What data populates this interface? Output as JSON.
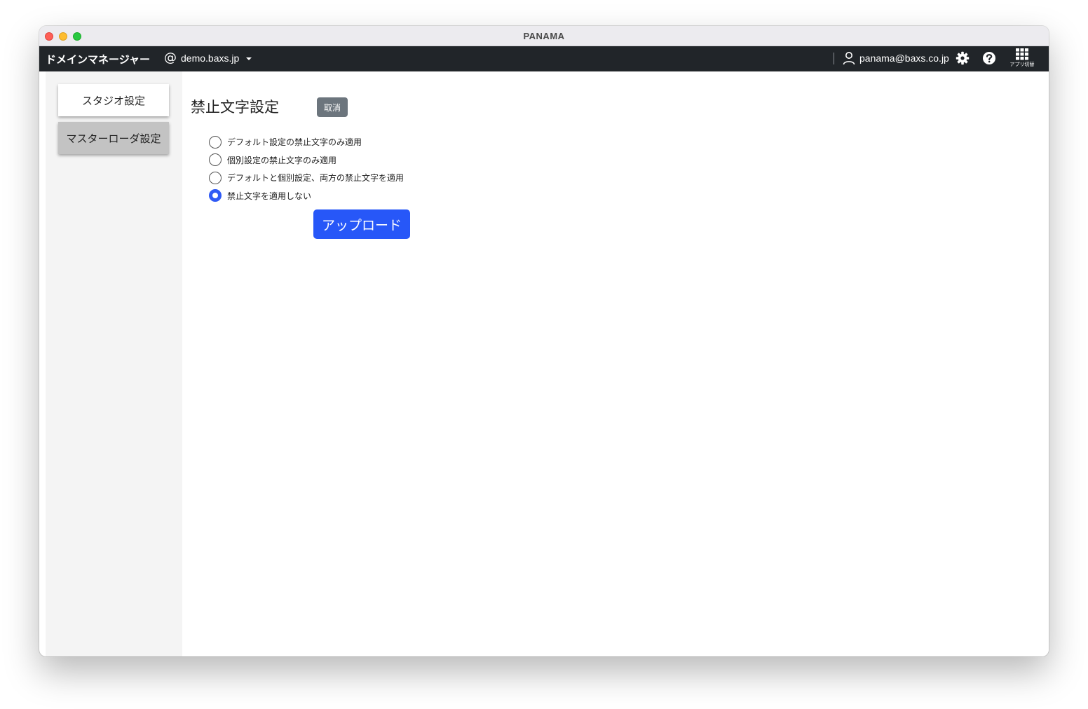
{
  "window": {
    "title": "PANAMA"
  },
  "navbar": {
    "brand": "ドメインマネージャー",
    "domain_icon": "at-icon",
    "domain": "demo.baxs.jp",
    "user_icon": "user-icon",
    "user_email": "panama@baxs.co.jp",
    "settings_icon": "gear-icon",
    "help_icon": "help-icon",
    "apps_icon": "grid-icon",
    "apps_label": "アプリ切替"
  },
  "sidebar": {
    "items": [
      {
        "label": "スタジオ設定",
        "active": true
      },
      {
        "label": "マスターローダ設定",
        "active": false
      }
    ]
  },
  "main": {
    "title": "禁止文字設定",
    "cancel_label": "取消",
    "options": [
      {
        "label": "デフォルト設定の禁止文字のみ適用",
        "checked": false
      },
      {
        "label": "個別設定の禁止文字のみ適用",
        "checked": false
      },
      {
        "label": "デフォルトと個別設定、両方の禁止文字を適用",
        "checked": false
      },
      {
        "label": "禁止文字を適用しない",
        "checked": true
      }
    ],
    "upload_label": "アップロード"
  },
  "colors": {
    "navbar_bg": "#212529",
    "accent": "#2757f8",
    "secondary": "#6c757d"
  }
}
